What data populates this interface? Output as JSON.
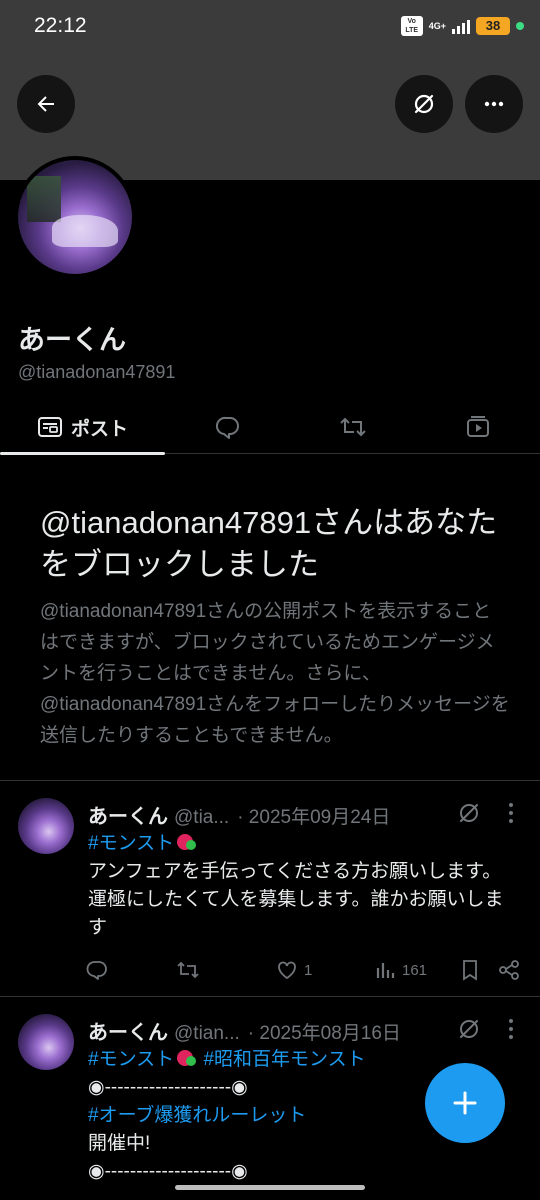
{
  "status": {
    "time": "22:12",
    "volte": "Vo LTE",
    "network": "4G+",
    "battery": "38"
  },
  "profile": {
    "name": "あーくん",
    "handle": "@tianadonan47891"
  },
  "tabs": [
    {
      "label": "ポスト"
    }
  ],
  "block": {
    "title": "@tianadonan47891さんはあなたをブロックしました",
    "description": "@tianadonan47891さんの公開ポストを表示することはできますが、ブロックされているためエンゲージメントを行うことはできません。さらに、@tianadonan47891さんをフォローしたりメッセージを送信したりすることもできません。"
  },
  "posts": [
    {
      "name": "あーくん",
      "handle": "@tia...",
      "date": "· 2025年09月24日",
      "hashtags": [
        "#モンスト"
      ],
      "text": "アンフェアを手伝ってくださる方お願いします。運極にしたくて人を募集します。誰かお願いします",
      "stats": {
        "likes": "1",
        "views": "161"
      }
    },
    {
      "name": "あーくん",
      "handle": "@tian...",
      "date": "· 2025年08月16日",
      "hashtags": [
        "#モンスト",
        "#昭和百年モンスト",
        "#オーブ爆獲れルーレット"
      ],
      "line_rule": "◉--------------------◉",
      "text": "開催中!"
    }
  ],
  "colors": {
    "accent": "#1d9bf0",
    "muted": "#71767b",
    "text": "#e7e9ea",
    "banner": "#3b3b3b",
    "battery": "#f5a623"
  },
  "icons": [
    "back-arrow-icon",
    "grok-slash-icon",
    "more-dots-icon",
    "posts-tab-icon",
    "reply-tab-icon",
    "repost-tab-icon",
    "media-tab-icon",
    "reply-icon",
    "repost-icon",
    "like-icon",
    "views-icon",
    "bookmark-icon",
    "share-icon",
    "plus-icon"
  ]
}
